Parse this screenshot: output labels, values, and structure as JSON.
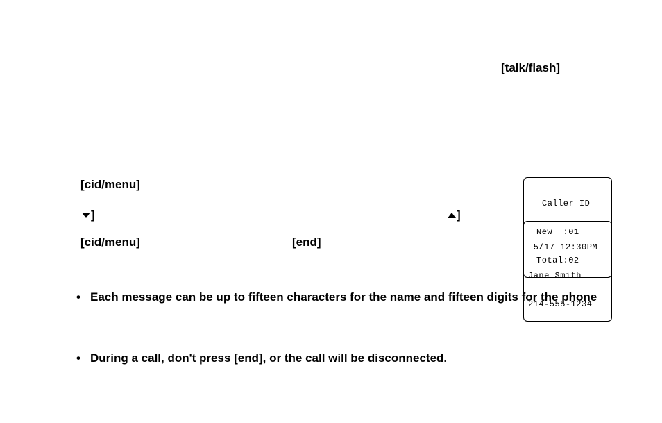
{
  "labels": {
    "talk_flash": "[talk/flash]",
    "cid_menu_1": "[cid/menu]",
    "arrow_down_bracket": "]",
    "arrow_up_bracket": "]",
    "cid_menu_2": "[cid/menu]",
    "end": "[end]"
  },
  "lcd1": {
    "line1": "Caller ID",
    "line2": "New  :01",
    "line3": "Total:02"
  },
  "lcd2": {
    "line1": " 5/17 12:30PM",
    "line2": "Jane Smith",
    "line3": "214-555-1234"
  },
  "bullets": [
    "Each message can be up to fifteen characters for the name and fifteen digits for the phone",
    "During a call, don't press [end], or the call will be disconnected."
  ]
}
